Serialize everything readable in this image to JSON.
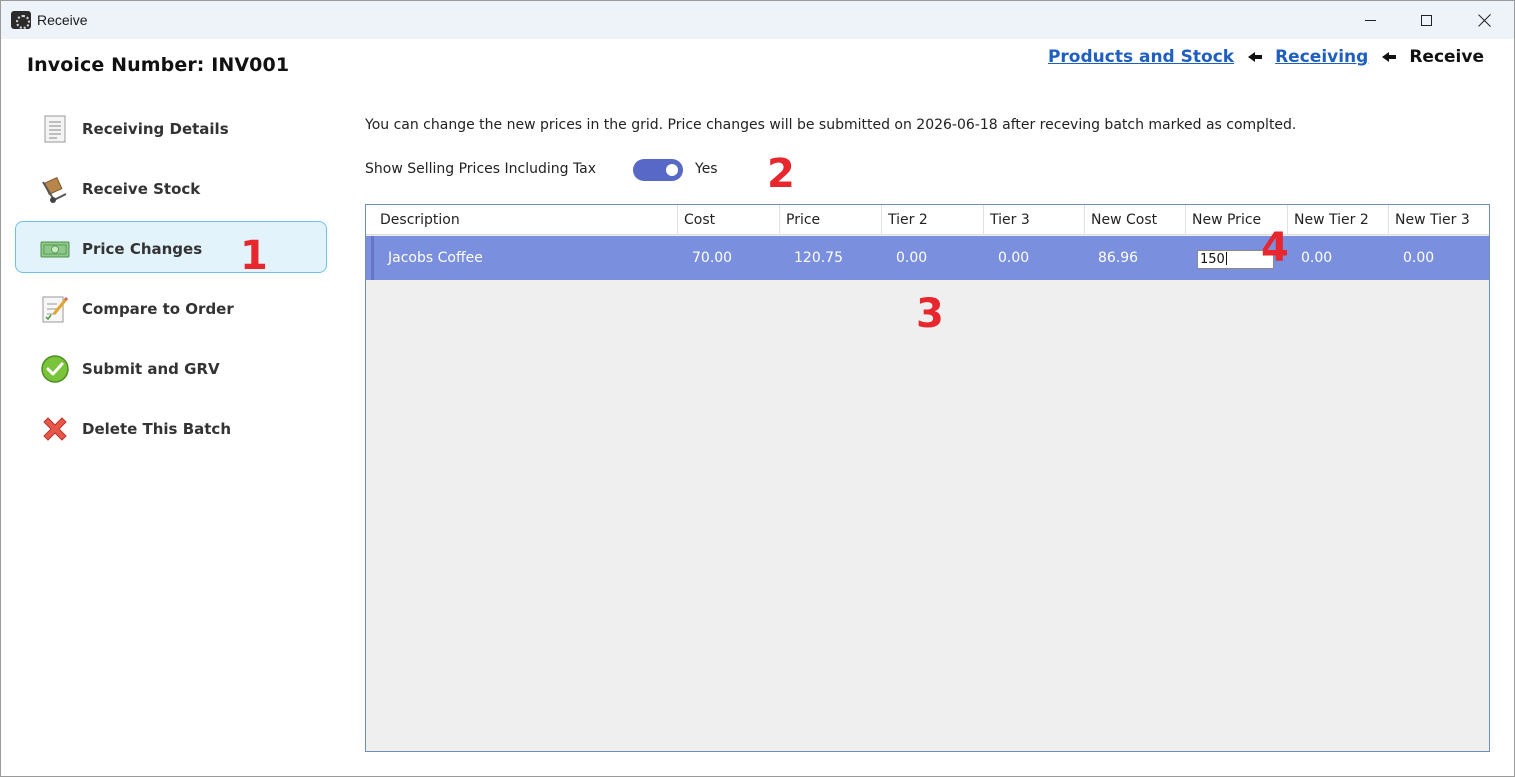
{
  "window": {
    "title": "Receive"
  },
  "header": {
    "invoice_label": "Invoice Number: INV001",
    "breadcrumb": [
      {
        "label": "Products and Stock",
        "link": true
      },
      {
        "label": "Receiving",
        "link": true
      },
      {
        "label": "Receive",
        "link": false
      }
    ]
  },
  "sidebar": {
    "items": [
      {
        "label": "Receiving Details",
        "icon": "document-icon",
        "active": false
      },
      {
        "label": "Receive Stock",
        "icon": "hand-truck-icon",
        "active": false
      },
      {
        "label": "Price Changes",
        "icon": "banknote-icon",
        "active": true
      },
      {
        "label": "Compare to Order",
        "icon": "checklist-pencil-icon",
        "active": false
      },
      {
        "label": "Submit and GRV",
        "icon": "check-circle-icon",
        "active": false
      },
      {
        "label": "Delete This Batch",
        "icon": "red-x-icon",
        "active": false
      }
    ]
  },
  "main": {
    "info_text": "You can change the new prices in the grid. Price changes will be submitted on 2026-06-18 after receving batch marked as complted.",
    "toggle": {
      "label": "Show Selling Prices Including Tax",
      "state_text": "Yes",
      "on": true
    },
    "grid": {
      "columns": [
        "Description",
        "Cost",
        "Price",
        "Tier 2",
        "Tier 3",
        "New Cost",
        "New Price",
        "New Tier 2",
        "New Tier 3"
      ],
      "rows": [
        {
          "cells": [
            "Jacobs Coffee",
            "70.00",
            "120.75",
            "0.00",
            "0.00",
            "86.96",
            "150",
            "0.00",
            "0.00"
          ],
          "selected": true,
          "editing_column": 6
        }
      ]
    }
  },
  "annotations": [
    "1",
    "2",
    "3",
    "4"
  ],
  "colors": {
    "accent": "#5868c6",
    "selected_row": "#7b8fdf",
    "active_nav_bg": "#e2f3fb",
    "active_nav_border": "#6cc3e6",
    "link": "#1f5fbf",
    "callout": "#e8262d"
  }
}
